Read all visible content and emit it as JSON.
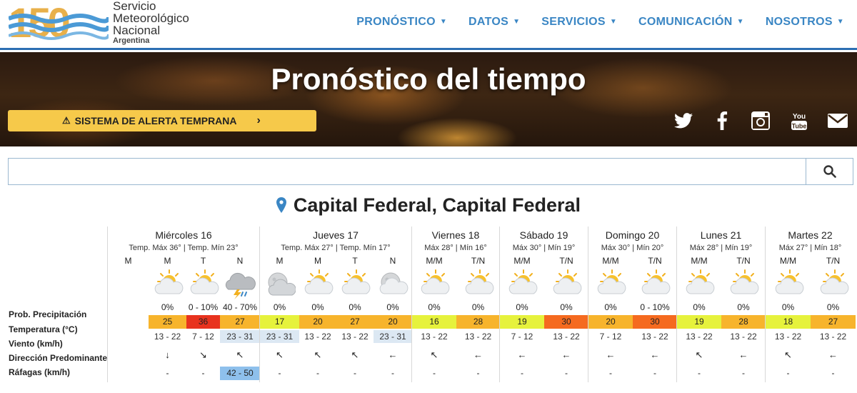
{
  "header": {
    "logo": {
      "number": "150",
      "line1": "Servicio",
      "line2": "Meteorológico",
      "line3": "Nacional",
      "line4": "Argentina"
    },
    "nav": [
      {
        "label": "PRONÓSTICO"
      },
      {
        "label": "DATOS"
      },
      {
        "label": "SERVICIOS"
      },
      {
        "label": "COMUNICACIÓN"
      },
      {
        "label": "NOSOTROS"
      }
    ]
  },
  "banner": {
    "title": "Pronóstico del tiempo",
    "alert_label": "SISTEMA DE ALERTA TEMPRANA",
    "socials": [
      "twitter-icon",
      "facebook-icon",
      "instagram-icon",
      "youtube-icon",
      "mail-icon"
    ]
  },
  "search": {
    "value": "",
    "placeholder": ""
  },
  "location": {
    "name": "Capital Federal, Capital Federal"
  },
  "row_labels": {
    "prob": "Prob. Precipitación",
    "temp": "Temperatura (°C)",
    "wind": "Viento (km/h)",
    "dir": "Dirección Predominante",
    "gust": "Ráfagas (km/h)"
  },
  "colors": {
    "accent": "#3a86c4",
    "alert": "#f6c94a",
    "temp_15_19": "#e6f23c",
    "temp_20_29": "#f7b42c",
    "temp_30_35": "#f56a1f",
    "temp_36_plus": "#e8331e",
    "wind_highlight": "#dce8f3",
    "gust_highlight": "#8ec0ec"
  },
  "days": [
    {
      "name": "Miércoles 16",
      "temps": "Temp. Máx 36° | Temp. Mín 23°",
      "cols": [
        {
          "period": "M",
          "icon": "",
          "prob": "",
          "temp": "",
          "wind": "",
          "dir": "",
          "gust": ""
        },
        {
          "period": "M",
          "icon": "partly-sunny-icon",
          "prob": "0%",
          "temp": "25",
          "temp_color": "#f7b42c",
          "wind": "13 - 22",
          "dir": "↓",
          "gust": "-"
        },
        {
          "period": "T",
          "icon": "partly-sunny-icon",
          "prob": "0 - 10%",
          "temp": "36",
          "temp_color": "#e8331e",
          "wind": "7 - 12",
          "dir": "↘",
          "gust": "-"
        },
        {
          "period": "N",
          "icon": "storm-icon",
          "prob": "40 - 70%",
          "temp": "27",
          "temp_color": "#f7b42c",
          "wind": "23 - 31",
          "wind_hl": true,
          "dir": "↖",
          "gust": "42 - 50",
          "gust_hl": true
        }
      ]
    },
    {
      "name": "Jueves 17",
      "temps": "Temp. Máx 27° | Temp. Mín 17°",
      "cols": [
        {
          "period": "M",
          "icon": "cloudy-night-icon",
          "prob": "0%",
          "temp": "17",
          "temp_color": "#e6f23c",
          "wind": "23 - 31",
          "wind_hl": true,
          "dir": "↖",
          "gust": "-"
        },
        {
          "period": "M",
          "icon": "partly-sunny-icon",
          "prob": "0%",
          "temp": "20",
          "temp_color": "#f7b42c",
          "wind": "13 - 22",
          "dir": "↖",
          "gust": "-"
        },
        {
          "period": "T",
          "icon": "partly-sunny-icon",
          "prob": "0%",
          "temp": "27",
          "temp_color": "#f7b42c",
          "wind": "13 - 22",
          "dir": "↖",
          "gust": "-"
        },
        {
          "period": "N",
          "icon": "partly-cloudy-night-icon",
          "prob": "0%",
          "temp": "20",
          "temp_color": "#f7b42c",
          "wind": "23 - 31",
          "wind_hl": true,
          "dir": "←",
          "gust": "-"
        }
      ]
    },
    {
      "name": "Viernes 18",
      "temps": "Máx 28° | Mín 16°",
      "cols": [
        {
          "period": "M/M",
          "icon": "partly-sunny-icon",
          "prob": "0%",
          "temp": "16",
          "temp_color": "#e6f23c",
          "wind": "13 - 22",
          "dir": "↖",
          "gust": "-"
        },
        {
          "period": "T/N",
          "icon": "partly-sunny-icon",
          "prob": "0%",
          "temp": "28",
          "temp_color": "#f7b42c",
          "wind": "13 - 22",
          "dir": "←",
          "gust": "-"
        }
      ]
    },
    {
      "name": "Sábado 19",
      "temps": "Máx 30° | Mín 19°",
      "cols": [
        {
          "period": "M/M",
          "icon": "partly-sunny-icon",
          "prob": "0%",
          "temp": "19",
          "temp_color": "#e6f23c",
          "wind": "7 - 12",
          "dir": "←",
          "gust": "-"
        },
        {
          "period": "T/N",
          "icon": "partly-sunny-icon",
          "prob": "0%",
          "temp": "30",
          "temp_color": "#f56a1f",
          "wind": "13 - 22",
          "dir": "←",
          "gust": "-"
        }
      ]
    },
    {
      "name": "Domingo 20",
      "temps": "Máx 30° | Mín 20°",
      "cols": [
        {
          "period": "M/M",
          "icon": "partly-sunny-icon",
          "prob": "0%",
          "temp": "20",
          "temp_color": "#f7b42c",
          "wind": "7 - 12",
          "dir": "←",
          "gust": "-"
        },
        {
          "period": "T/N",
          "icon": "partly-sunny-icon",
          "prob": "0 - 10%",
          "temp": "30",
          "temp_color": "#f56a1f",
          "wind": "13 - 22",
          "dir": "←",
          "gust": "-"
        }
      ]
    },
    {
      "name": "Lunes 21",
      "temps": "Máx 28° | Mín 19°",
      "cols": [
        {
          "period": "M/M",
          "icon": "partly-sunny-icon",
          "prob": "0%",
          "temp": "19",
          "temp_color": "#e6f23c",
          "wind": "13 - 22",
          "dir": "↖",
          "gust": "-"
        },
        {
          "period": "T/N",
          "icon": "partly-sunny-icon",
          "prob": "0%",
          "temp": "28",
          "temp_color": "#f7b42c",
          "wind": "13 - 22",
          "dir": "←",
          "gust": "-"
        }
      ]
    },
    {
      "name": "Martes 22",
      "temps": "Máx 27° | Mín 18°",
      "cols": [
        {
          "period": "M/M",
          "icon": "partly-sunny-icon",
          "prob": "0%",
          "temp": "18",
          "temp_color": "#e6f23c",
          "wind": "13 - 22",
          "dir": "↖",
          "gust": "-"
        },
        {
          "period": "T/N",
          "icon": "partly-sunny-icon",
          "prob": "0%",
          "temp": "27",
          "temp_color": "#f7b42c",
          "wind": "13 - 22",
          "dir": "←",
          "gust": "-"
        }
      ]
    }
  ]
}
